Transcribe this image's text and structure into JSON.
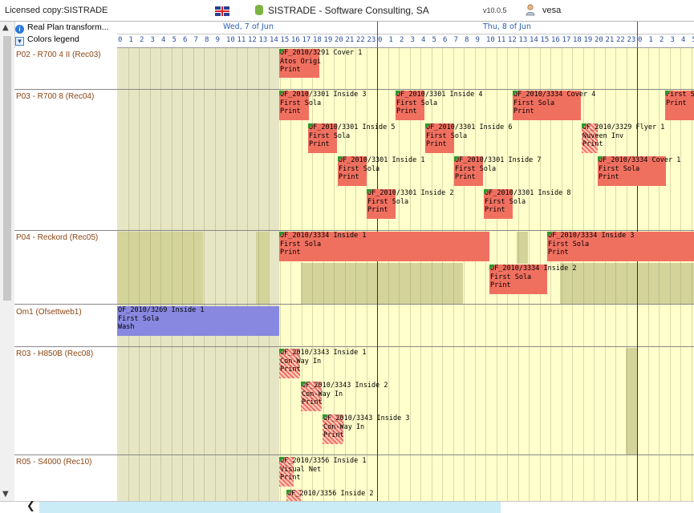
{
  "topbar": {
    "license": "Licensed copy:SISTRADE",
    "company": "SISTRADE - Software Consulting, SA",
    "version": "v10.0.5",
    "user": "vesa"
  },
  "icons": {
    "flag": "uk-flag-icon",
    "db": "database-icon",
    "user": "user-icon",
    "info": "info-icon",
    "chevron": "chevron-down-icon"
  },
  "controls": {
    "plan": "Real Plan transform...",
    "legend": "Colors legend"
  },
  "days": [
    {
      "label": "Wed, 7 of Jun"
    },
    {
      "label": "Thu, 8 of Jun"
    }
  ],
  "hours_text": [
    "0",
    "1",
    "2",
    "3",
    "4",
    "5",
    "6",
    "7",
    "8",
    "9",
    "10",
    "11",
    "12",
    "13",
    "14",
    "15",
    "16",
    "17",
    "18",
    "19",
    "20",
    "21",
    "22",
    "23",
    "0",
    "1",
    "2",
    "3",
    "4",
    "5",
    "6",
    "7",
    "8",
    "9",
    "10",
    "11",
    "12",
    "13",
    "14",
    "15",
    "16",
    "17",
    "18",
    "19",
    "20",
    "21",
    "22",
    "23",
    "0",
    "1",
    "2",
    "3",
    "4",
    "5"
  ],
  "resources": [
    {
      "label": "P02 - R700 4 II (Rec03)"
    },
    {
      "label": "P03 - R700 8 (Rec04)"
    },
    {
      "label": "P04 - Reckord (Rec05)"
    },
    {
      "label": "Om1 (Ofsettweb1)"
    },
    {
      "label": "R03 - H850B (Rec08)"
    },
    {
      "label": "R05 - S4000 (Rec10)"
    }
  ],
  "colors": {
    "red": "#f07060",
    "blue": "#8888e0",
    "past": "#e6e6c4",
    "future": "#ffffcc",
    "olive": "#d3d39a"
  },
  "events": [
    {
      "l1": "OF_2010/3291 Cover 1",
      "l2": "Atos Origi",
      "l3": "Print"
    },
    {
      "l1": "OF_2010/3301 Inside 3",
      "l2": "First Sola",
      "l3": "Print"
    },
    {
      "l1": "OF_2010/3301 Inside 4",
      "l2": "First Sola",
      "l3": "Print"
    },
    {
      "l1": "OF_2010/3334 Cover 4",
      "l2": "First Sola",
      "l3": "Print"
    },
    {
      "l1": "",
      "l2": "First Sol",
      "l3": "Print"
    },
    {
      "l1": "OF_2010/3301 Inside 5",
      "l2": "First Sola",
      "l3": "Print"
    },
    {
      "l1": "OF_2010/3301 Inside 6",
      "l2": "First Sola",
      "l3": "Print"
    },
    {
      "l1": "OF_2010/3329 Flyer 1",
      "l2": "Nuveen Inv",
      "l3": "Print"
    },
    {
      "l1": "OF_2010/3301 Inside 1",
      "l2": "First Sola",
      "l3": "Print"
    },
    {
      "l1": "OF_2010/3301 Inside 7",
      "l2": "First Sola",
      "l3": "Print"
    },
    {
      "l1": "OF_2010/3334 Cover 1",
      "l2": "First Sola",
      "l3": "Print"
    },
    {
      "l1": "OF_2010/3301 Inside 2",
      "l2": "First Sola",
      "l3": "Print"
    },
    {
      "l1": "OF_2010/3301 Inside 8",
      "l2": "First Sola",
      "l3": "Print"
    },
    {
      "l1": "OF_2010/3334 Inside 1",
      "l2": "First Sola",
      "l3": "Print"
    },
    {
      "l1": "OF_2010/3334 Inside 3",
      "l2": "First Sola",
      "l3": "Print"
    },
    {
      "l1": "OF_2010/3334 Inside 2",
      "l2": "First Sola",
      "l3": "Print"
    },
    {
      "l1": "OF_2010/3269 Inside 1",
      "l2": "First Sola",
      "l3": "Wash"
    },
    {
      "l1": "OF_2010/3343 Inside 1",
      "l2": "Con-Way In",
      "l3": "Print"
    },
    {
      "l1": "OF_2010/3343 Inside 2",
      "l2": "Con-Way In",
      "l3": "Print"
    },
    {
      "l1": "OF_2010/3343 Inside 3",
      "l2": "Con-Way In",
      "l3": "Print"
    },
    {
      "l1": "OF_2010/3356 Inside 1",
      "l2": "Visual Net",
      "l3": "Print"
    },
    {
      "l1": "OF_2010/3356 Inside 2",
      "l2": "",
      "l3": ""
    }
  ]
}
